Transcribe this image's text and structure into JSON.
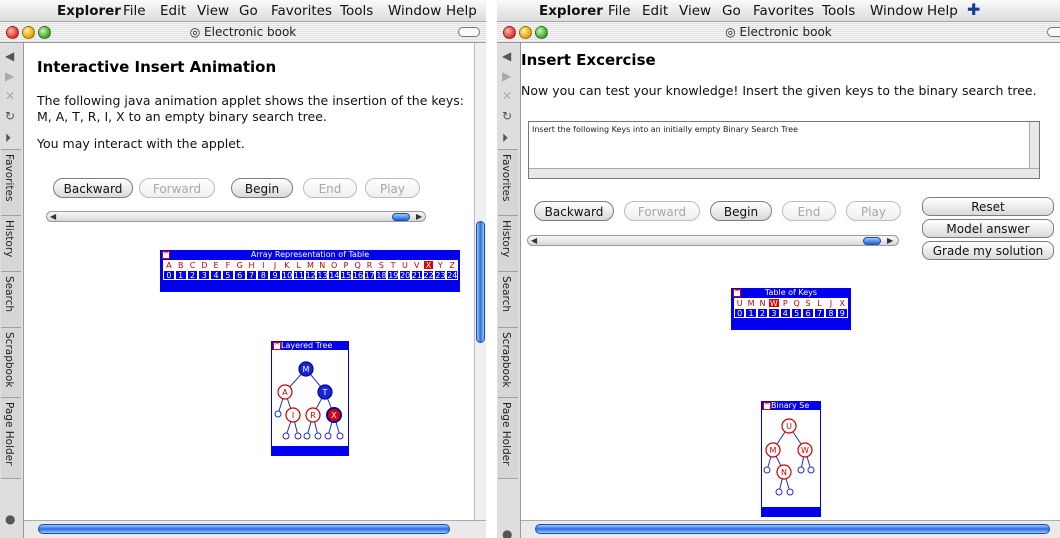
{
  "left": {
    "menu": {
      "app": "Explorer",
      "items": [
        "File",
        "Edit",
        "View",
        "Go",
        "Favorites",
        "Tools",
        "Window",
        "Help"
      ]
    },
    "window_title": "Electronic book",
    "heading": "Interactive Insert Animation",
    "para1": [
      "The following java animation applet shows the insertion of the keys:",
      "M, A, T, R, I, X to an empty binary search tree."
    ],
    "para2": "You may interact with the applet.",
    "buttons": {
      "backward": "Backward",
      "forward": "Forward",
      "begin": "Begin",
      "end": "End",
      "play": "Play"
    },
    "array_table": {
      "title": "Array Representation of Table",
      "mark": "^",
      "letters": [
        "A",
        "B",
        "C",
        "D",
        "E",
        "F",
        "G",
        "H",
        "I",
        "J",
        "K",
        "L",
        "M",
        "N",
        "O",
        "P",
        "Q",
        "R",
        "S",
        "T",
        "U",
        "V",
        "X",
        "Y",
        "Z"
      ],
      "indices": [
        "0",
        "1",
        "2",
        "3",
        "4",
        "5",
        "6",
        "7",
        "8",
        "9",
        "10",
        "11",
        "12",
        "13",
        "14",
        "15",
        "16",
        "17",
        "18",
        "19",
        "20",
        "21",
        "22",
        "23",
        "24"
      ]
    },
    "tree": {
      "title": "Layered Tree",
      "mark": "^",
      "nodes": [
        "M",
        "A",
        "T",
        "I",
        "R",
        "X"
      ]
    },
    "sidebar_tabs": [
      "Favorites",
      "History",
      "Search",
      "Scrapbook",
      "Page Holder"
    ]
  },
  "right": {
    "menu": {
      "app": "Explorer",
      "items": [
        "File",
        "Edit",
        "View",
        "Go",
        "Favorites",
        "Tools",
        "Window",
        "Help"
      ]
    },
    "window_title": "Electronic book",
    "heading": "Insert Excercise",
    "para1": "Now you can test your knowledge! Insert the given keys to the binary search tree.",
    "textarea": "Insert the following Keys into an initially empty Binary Search Tree",
    "buttons": {
      "backward": "Backward",
      "forward": "Forward",
      "begin": "Begin",
      "end": "End",
      "play": "Play",
      "reset": "Reset",
      "model_answer": "Model answer",
      "grade": "Grade my solution"
    },
    "keys_table": {
      "title": "Table of Keys",
      "mark": "^",
      "letters": [
        "U",
        "M",
        "N",
        "W",
        "P",
        "Q",
        "S",
        "L",
        "J",
        "X"
      ],
      "indices": [
        "0",
        "1",
        "2",
        "3",
        "4",
        "5",
        "6",
        "7",
        "8",
        "9"
      ]
    },
    "tree": {
      "title": "Binary Se",
      "mark": "^",
      "nodes": [
        "U",
        "M",
        "W",
        "N"
      ]
    },
    "sidebar_tabs": [
      "Favorites",
      "History",
      "Search",
      "Scrapbook",
      "Page Holder"
    ]
  },
  "colors": {
    "applet_blue": "#0000ee",
    "highlight_red": "#e00000",
    "scroll_blue": "#2a6fe0"
  }
}
